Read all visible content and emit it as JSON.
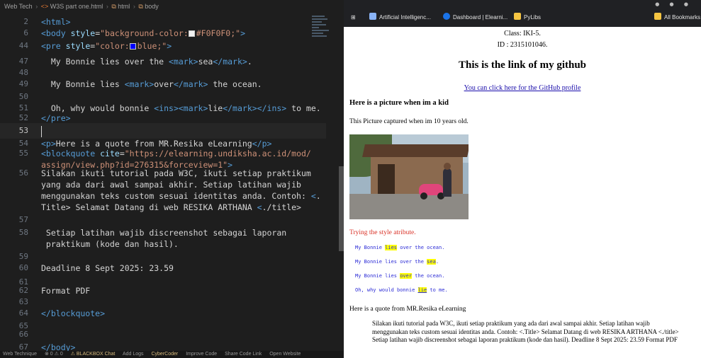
{
  "editor": {
    "breadcrumb": [
      "Web Tech",
      "W3S part one.html",
      "html",
      "body"
    ],
    "lines": [
      {
        "n": "2",
        "html": "<span class='tag'>&lt;html&gt;</span>"
      },
      {
        "n": "6",
        "html": "<span class='tag'>&lt;body</span> <span class='attr'>style</span>=<span class='str'>\"background-color:<span class='swatch' style='background:#f0f0f0'></span>#F0F0F0;\"</span><span class='tag'>&gt;</span>"
      },
      {
        "n": "44",
        "html": "<span class='tag'>&lt;pre</span> <span class='attr'>style</span>=<span class='str'>\"color:<span class='swatch' style='background:#0000ff'></span>blue;\"</span><span class='tag'>&gt;</span>"
      },
      {
        "n": "47",
        "html": "  My Bonnie lies over the <span class='tag'>&lt;mark&gt;</span>sea<span class='tag'>&lt;/mark&gt;</span>."
      },
      {
        "n": "48",
        "html": ""
      },
      {
        "n": "49",
        "html": "  My Bonnie lies <span class='tag'>&lt;mark&gt;</span>over<span class='tag'>&lt;/mark&gt;</span> the ocean."
      },
      {
        "n": "50",
        "html": ""
      },
      {
        "n": "51",
        "html": "  Oh, why would bonnie <span class='tag'>&lt;ins&gt;&lt;mark&gt;</span>lie<span class='tag'>&lt;/mark&gt;&lt;/ins&gt;</span> to me."
      },
      {
        "n": "52",
        "html": "<span class='tag'>&lt;/pre&gt;</span>"
      },
      {
        "n": "53",
        "html": "<span class='cursor'></span>"
      },
      {
        "n": "54",
        "html": "<span class='tag'>&lt;p&gt;</span>Here is a quote from MR.Resika eLearning<span class='tag'>&lt;/p&gt;</span>"
      },
      {
        "n": "55",
        "html": "<span class='tag'>&lt;blockquote</span> <span class='attr'>cite</span>=<span class='str'>\"https://elearning.undiksha.ac.id/mod/</span>"
      },
      {
        "n": "",
        "html": "<span class='str'>assign/view.php?id=276315&amp;forceview=1\"</span><span class='tag'>&gt;</span>"
      },
      {
        "n": "56",
        "html": "Silakan ikuti tutorial pada W3C, ikuti setiap praktikum"
      },
      {
        "n": "",
        "html": "yang ada dari awal sampai akhir. Setiap latihan wajib"
      },
      {
        "n": "",
        "html": "menggunakan teks custom sesuai identitas anda. Contoh: <span class='tag'>&lt;</span>."
      },
      {
        "n": "",
        "html": "Title&gt; Selamat Datang di web RESIKA ARTHANA <span class='tag'>&lt;</span>./title&gt;"
      },
      {
        "n": "57",
        "html": ""
      },
      {
        "n": "58",
        "html": " Setiap latihan wajib discreenshot sebagai laporan"
      },
      {
        "n": "",
        "html": " praktikum (kode dan hasil)."
      },
      {
        "n": "59",
        "html": ""
      },
      {
        "n": "60",
        "html": "Deadline 8 Sept 2025: 23.59"
      },
      {
        "n": "61",
        "html": ""
      },
      {
        "n": "62",
        "html": "Format PDF"
      },
      {
        "n": "63",
        "html": ""
      },
      {
        "n": "64",
        "html": "<span class='tag'>&lt;/blockquote&gt;</span>"
      },
      {
        "n": "65",
        "html": ""
      },
      {
        "n": "66",
        "html": ""
      },
      {
        "n": "67",
        "html": "<span class='tag'>&lt;/body&gt;</span>"
      }
    ],
    "statusbar": [
      "Web Technique",
      "⊗ 0 ⚠ 0",
      "⚠ BLACKBOX Chat",
      "Add Logs",
      "CyberCoder",
      "Improve Code",
      "Share Code Link",
      "Open Website"
    ]
  },
  "browser": {
    "bookmarks": [
      "Artificial Intelligenc...",
      "Dashboard | Elearni...",
      "PyLibs",
      "All Bookmarks"
    ],
    "page": {
      "class_text": "Class: IKI-5.",
      "id_text": "ID : 2315101046.",
      "github_heading": "This is the link of my github",
      "github_link": "You can click here for the GitHub profile",
      "kid_heading": "Here is a picture when im a kid",
      "photo_caption": "This Picture captured when im 10 years old.",
      "style_line": "Trying the style atribute.",
      "pre_lines": [
        {
          "pre": "My Bonnie ",
          "mark": "lies",
          "post": " over the ocean.",
          "ins": false
        },
        {
          "pre": "My Bonnie lies over the ",
          "mark": "sea",
          "post": ".",
          "ins": false
        },
        {
          "pre": "My Bonnie lies ",
          "mark": "over",
          "post": " the ocean.",
          "ins": false
        },
        {
          "pre": "Oh, why would bonnie ",
          "mark": "lie",
          "post": " to me.",
          "ins": true
        }
      ],
      "quote_intro": "Here is a quote from MR.Resika eLearning",
      "quote_body": "Silakan ikuti tutorial pada W3C, ikuti setiap praktikum yang ada dari awal sampai akhir. Setiap latihan wajib menggunakan teks custom sesuai identitas anda. Contoh: <.Title> Selamat Datang di web RESIKA ARTHANA <./title> Setiap latihan wajib discreenshot sebagai laporan praktikum (kode dan hasil). Deadline 8 Sept 2025: 23.59 Format PDF"
    }
  },
  "colors": {
    "editor_bg": "#1e1e1e",
    "tag": "#569cd6",
    "attr": "#9cdcfe",
    "string": "#ce9178",
    "link": "#1a0dab",
    "style_red": "#d93025",
    "pre_blue": "#2b2bd6",
    "mark_yellow": "#ffff00"
  }
}
